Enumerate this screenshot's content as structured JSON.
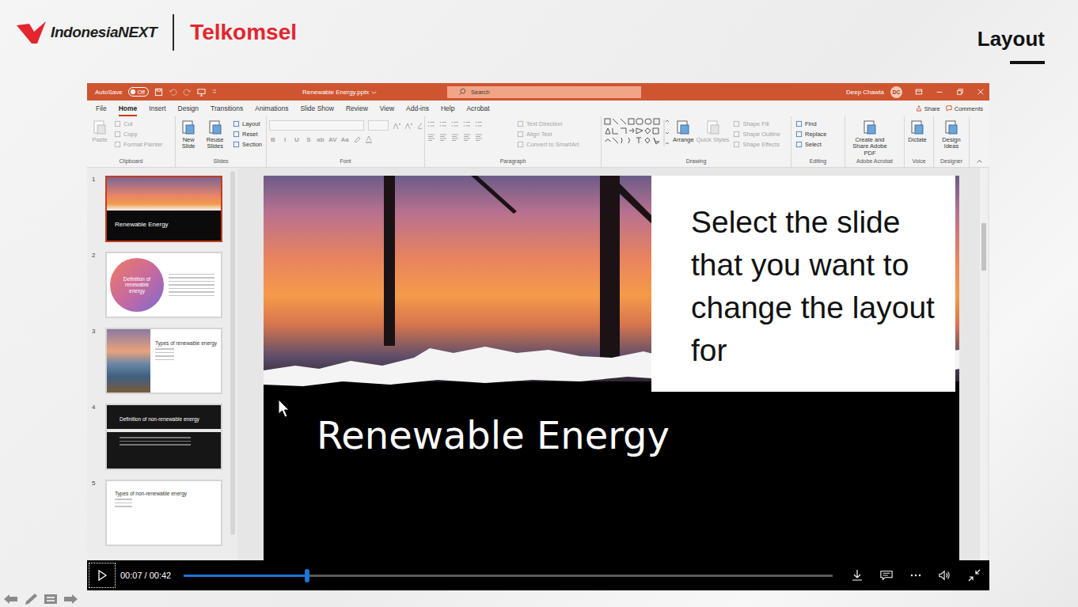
{
  "brand": {
    "name": "IndonesiaNEXT",
    "partner": "Telkomsel"
  },
  "page_title": "Layout",
  "app": {
    "autosave": {
      "label": "AutoSave",
      "state": "Off",
      "on": false
    },
    "filename": "Renewable Energy.pptx",
    "search_placeholder": "Search",
    "user": "Deep Chawla",
    "initials": "DC",
    "tabs": [
      {
        "label": "File",
        "selected": false
      },
      {
        "label": "Home",
        "selected": true
      },
      {
        "label": "Insert",
        "selected": false
      },
      {
        "label": "Design",
        "selected": false
      },
      {
        "label": "Transitions",
        "selected": false
      },
      {
        "label": "Animations",
        "selected": false
      },
      {
        "label": "Slide Show",
        "selected": false
      },
      {
        "label": "Review",
        "selected": false
      },
      {
        "label": "View",
        "selected": false
      },
      {
        "label": "Add-ins",
        "selected": false
      },
      {
        "label": "Help",
        "selected": false
      },
      {
        "label": "Acrobat",
        "selected": false
      }
    ],
    "share": "Share",
    "comments": "Comments",
    "ribbon_groups": [
      {
        "name": "Clipboard",
        "kind": "buttons",
        "items": [
          {
            "label": "Paste",
            "kind": "large",
            "disabled": true
          },
          {
            "label": "Cut",
            "kind": "small",
            "disabled": true
          },
          {
            "label": "Copy",
            "kind": "small",
            "disabled": true
          },
          {
            "label": "Format Painter",
            "kind": "small",
            "disabled": true
          }
        ]
      },
      {
        "name": "Slides",
        "kind": "buttons",
        "items": [
          {
            "label": "New Slide",
            "kind": "large",
            "disabled": false
          },
          {
            "label": "Reuse Slides",
            "kind": "large",
            "disabled": false
          },
          {
            "label": "Layout",
            "kind": "small",
            "disabled": false
          },
          {
            "label": "Reset",
            "kind": "small",
            "disabled": false
          },
          {
            "label": "Section",
            "kind": "small",
            "disabled": false
          }
        ]
      },
      {
        "name": "Font",
        "kind": "font",
        "items": [
          {
            "label": "B",
            "kind": "glyph",
            "disabled": true
          },
          {
            "label": "I",
            "kind": "glyph",
            "disabled": true
          },
          {
            "label": "U",
            "kind": "glyph",
            "disabled": true
          },
          {
            "label": "S",
            "kind": "glyph",
            "disabled": true
          },
          {
            "label": "ab",
            "kind": "glyph",
            "disabled": true
          },
          {
            "label": "AV",
            "kind": "glyph",
            "disabled": true
          },
          {
            "label": "Aa",
            "kind": "glyph",
            "disabled": true
          }
        ]
      },
      {
        "name": "Paragraph",
        "kind": "paragraph",
        "items": [
          {
            "label": "Text Direction",
            "kind": "small",
            "disabled": true
          },
          {
            "label": "Align Text",
            "kind": "small",
            "disabled": true
          },
          {
            "label": "Convert to SmartArt",
            "kind": "small",
            "disabled": true
          }
        ]
      },
      {
        "name": "Drawing",
        "kind": "drawing",
        "items": [
          {
            "label": "Arrange",
            "kind": "large",
            "disabled": false
          },
          {
            "label": "Quick Styles",
            "kind": "large",
            "disabled": true
          },
          {
            "label": "Shape Fill",
            "kind": "small",
            "disabled": true
          },
          {
            "label": "Shape Outline",
            "kind": "small",
            "disabled": true
          },
          {
            "label": "Shape Effects",
            "kind": "small",
            "disabled": true
          }
        ]
      },
      {
        "name": "Editing",
        "kind": "buttons",
        "items": [
          {
            "label": "Find",
            "kind": "small",
            "disabled": false
          },
          {
            "label": "Replace",
            "kind": "small",
            "disabled": false
          },
          {
            "label": "Select",
            "kind": "small",
            "disabled": false
          }
        ]
      },
      {
        "name": "Adobe Acrobat",
        "kind": "buttons",
        "items": [
          {
            "label": "Create and Share Adobe PDF",
            "kind": "large",
            "disabled": false
          }
        ]
      },
      {
        "name": "Voice",
        "kind": "buttons",
        "items": [
          {
            "label": "Dictate",
            "kind": "large",
            "disabled": false
          }
        ]
      },
      {
        "name": "Designer",
        "kind": "buttons",
        "items": [
          {
            "label": "Design Ideas",
            "kind": "large",
            "disabled": false
          }
        ]
      }
    ]
  },
  "slides": [
    {
      "number": "1",
      "title": "Renewable Energy",
      "kind": "cover",
      "selected": true
    },
    {
      "number": "2",
      "title": "Definition of renewable energy",
      "kind": "circle",
      "selected": false
    },
    {
      "number": "3",
      "title": "Types of renewable energy",
      "kind": "photo-side",
      "selected": false
    },
    {
      "number": "4",
      "title": "Definition of non-renewable energy",
      "kind": "dark",
      "selected": false
    },
    {
      "number": "5",
      "title": "Types of non-renewable energy",
      "kind": "plain",
      "selected": false
    }
  ],
  "slide": {
    "title": "Renewable Energy"
  },
  "callout": "Select the slide that you want to change the layout for",
  "player": {
    "time": "00:07 / 00:42",
    "level": 0.19,
    "playing": false
  }
}
